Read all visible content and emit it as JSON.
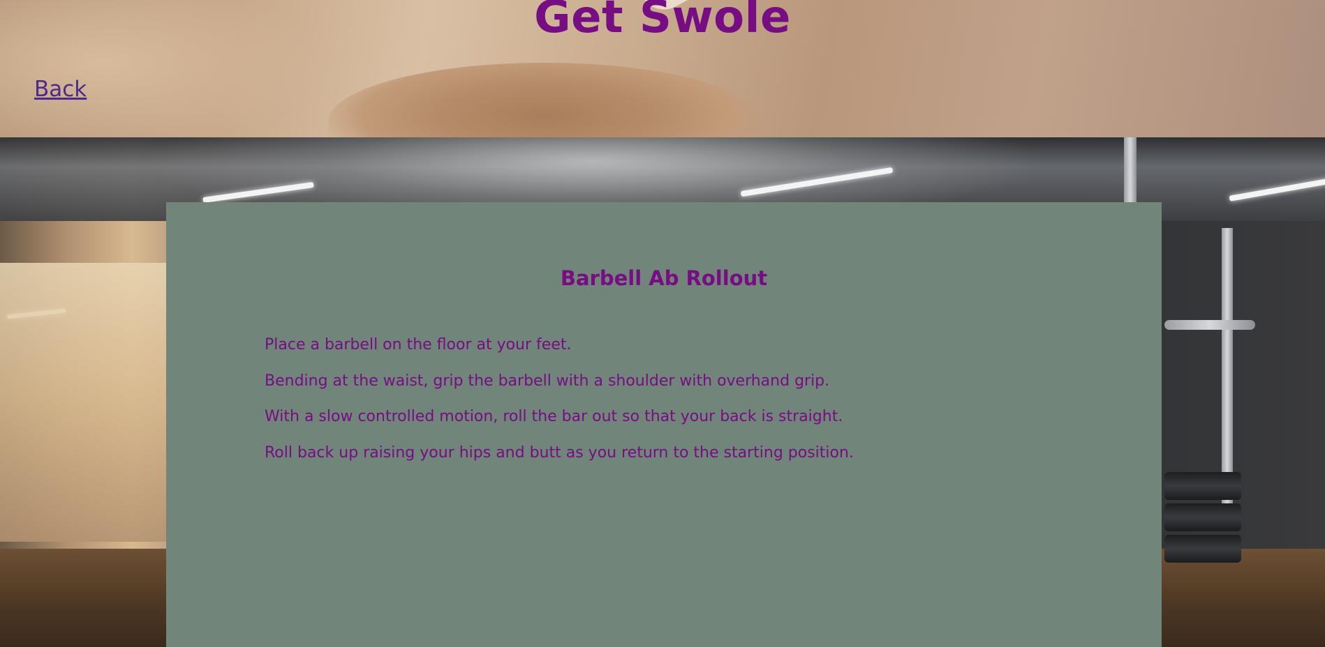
{
  "header": {
    "title": "Get Swole",
    "back_label": "Back"
  },
  "exercise": {
    "title": "Barbell Ab Rollout",
    "steps": [
      "Place a barbell on the floor at your feet.",
      "Bending at the waist, grip the barbell with a shoulder with overhand grip.",
      "With a slow controlled motion, roll the bar out so that your back is straight.",
      "Roll back up raising your hips and butt as you return to the starting position."
    ]
  },
  "colors": {
    "title": "#770d83",
    "link": "#4b2a8a",
    "panel_background": "#71857a"
  }
}
